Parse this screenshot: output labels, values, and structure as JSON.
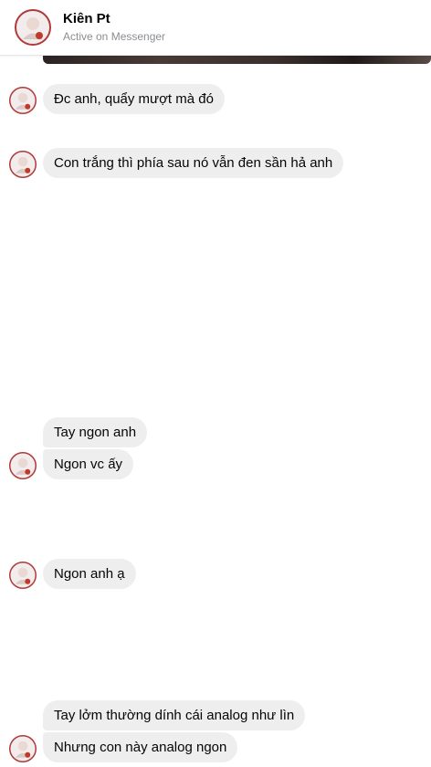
{
  "contact": {
    "name": "Kiên Pt",
    "status": "Active on Messenger"
  },
  "messages": [
    {
      "text": "Đc anh, quẩy mượt mà đó"
    },
    {
      "text": "Con trắng thì phía sau nó vẫn đen sần hả anh"
    },
    {
      "text": "Tay ngon anh"
    },
    {
      "text": "Ngon vc ấy"
    },
    {
      "text": "Ngon anh ạ"
    },
    {
      "text": "Tay lởm thường dính cái analog như lìn"
    },
    {
      "text": "Nhưng con này analog ngon"
    }
  ],
  "colors": {
    "bubble_bg": "#eeeeee",
    "status_text": "#8a8d91",
    "avatar_ring": "#c0392b"
  },
  "icons": {
    "avatar": "profile-photo"
  }
}
